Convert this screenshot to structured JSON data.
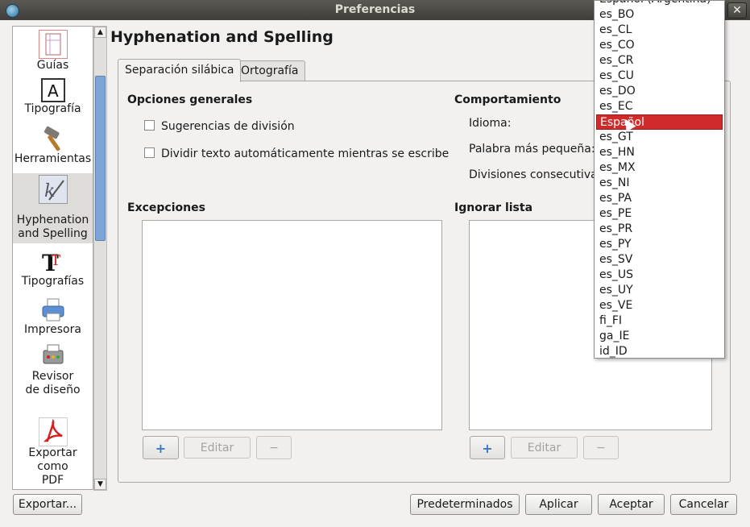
{
  "window": {
    "title": "Preferencias",
    "close_label": "✕"
  },
  "sidebar": {
    "items": [
      {
        "label": "Guías",
        "icon": "guides-icon"
      },
      {
        "label": "Tipografía",
        "icon": "typography-icon"
      },
      {
        "label": "Herramientas",
        "icon": "hammer-icon"
      },
      {
        "label": "Hyphenation and Spelling",
        "icon": "hyphenation-icon"
      },
      {
        "label": "Tipografías",
        "icon": "fonts-icon"
      },
      {
        "label": "Impresora",
        "icon": "printer-icon"
      },
      {
        "label": "Revisor de diseño",
        "icon": "preflight-icon"
      },
      {
        "label": "Exportar como PDF",
        "icon": "pdf-icon"
      }
    ],
    "selected": "Hyphenation and Spelling"
  },
  "page": {
    "title": "Hyphenation and Spelling"
  },
  "tabs": [
    {
      "label": "Separación silábica",
      "active": true
    },
    {
      "label": "Ortografía",
      "active": false
    }
  ],
  "general": {
    "title": "Opciones generales",
    "option1": "Sugerencias de división",
    "option2": "Dividir texto automáticamente mientras se escribe"
  },
  "behavior": {
    "title": "Comportamiento",
    "language_label": "Idioma:",
    "smallest_word_label": "Palabra más pequeña:",
    "consecutive_label": "Divisiones consecutivas:"
  },
  "exceptions": {
    "title": "Excepciones",
    "edit_label": "Editar",
    "add_label": "+",
    "remove_label": "−"
  },
  "ignore": {
    "title": "Ignorar lista",
    "edit_label": "Editar",
    "add_label": "+",
    "remove_label": "−"
  },
  "dropdown": {
    "partial_top": "Español (Argentina)",
    "items": [
      "es_BO",
      "es_CL",
      "es_CO",
      "es_CR",
      "es_CU",
      "es_DO",
      "es_EC",
      "Español",
      "es_GT",
      "es_HN",
      "es_MX",
      "es_NI",
      "es_PA",
      "es_PE",
      "es_PR",
      "es_PY",
      "es_SV",
      "es_US",
      "es_UY",
      "es_VE",
      "fi_FI",
      "ga_IE",
      "id_ID"
    ],
    "selected": "Español"
  },
  "buttons": {
    "export": "Exportar...",
    "defaults": "Predeterminados",
    "apply": "Aplicar",
    "accept": "Aceptar",
    "cancel": "Cancelar"
  },
  "colors": {
    "selection": "#cf2b2b",
    "sidebar_thumb": "#7fa4d6",
    "titlebar": "#3f3e3a"
  }
}
